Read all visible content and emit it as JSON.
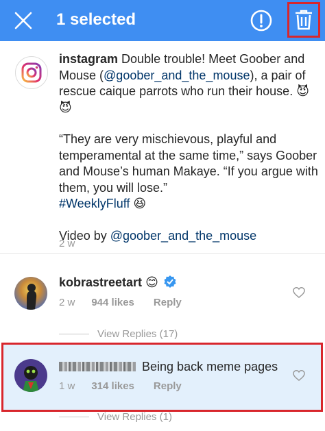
{
  "header": {
    "selected_label": "1 selected",
    "close_icon": "close-icon",
    "report_icon": "report-icon",
    "delete_icon": "trash-icon",
    "bar_color": "#3f8ef2",
    "highlight_color": "#d8262c"
  },
  "caption": {
    "username": "instagram",
    "text_1": "Double trouble! Meet Goober and Mouse (",
    "mention_1": "@goober_and_the_mouse",
    "text_2": "), a pair of rescue caique parrots who run their house. 😈😈",
    "quote": "“They are very mischievous, playful and temperamental at the same time,” says Goober and Mouse’s human Makaye. “If you argue with them, you will lose.”",
    "hashtag": "#WeeklyFluff",
    "emoji": "😆",
    "video_by": "Video by ",
    "mention_2": "@goober_and_the_mouse",
    "time": "2 w"
  },
  "comments": [
    {
      "username": "kobrastreetart",
      "text": "😊",
      "time": "2 w",
      "likes": "944 likes",
      "reply": "Reply",
      "view_replies": "View Replies (17)"
    },
    {
      "username": "",
      "text": "Being back meme pages",
      "time": "1 w",
      "likes": "314 likes",
      "reply": "Reply",
      "view_replies": "View Replies (1)"
    }
  ]
}
